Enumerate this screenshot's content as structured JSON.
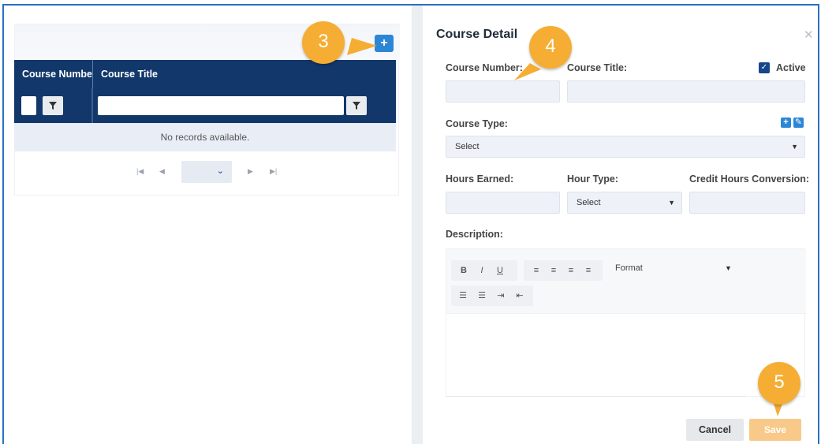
{
  "grid": {
    "columns": [
      "Course Numbe",
      "Course Title"
    ],
    "no_records": "No records available.",
    "add_icon": "plus-icon",
    "filter_icon": "filter-icon",
    "pager_icons": [
      "first-page-icon",
      "prev-page-icon",
      "next-page-icon",
      "last-page-icon"
    ]
  },
  "modal": {
    "title": "Course Detail",
    "close_icon": "close-icon",
    "course_number_label": "Course Number:",
    "course_title_label": "Course Title:",
    "active_label": "Active",
    "active_checked": true,
    "course_type_label": "Course Type:",
    "course_type_value": "Select",
    "hours_earned_label": "Hours Earned:",
    "hour_type_label": "Hour Type:",
    "hour_type_value": "Select",
    "credit_hours_label": "Credit Hours Conversion:",
    "description_label": "Description:",
    "editor_toolbar": [
      "B",
      "I",
      "U"
    ],
    "format_label": "Format",
    "cancel_label": "Cancel",
    "save_label": "Save"
  },
  "callouts": [
    "3",
    "4",
    "5"
  ],
  "colors": {
    "grid_header": "#12386b",
    "accent_blue": "#2b86d6",
    "callout_orange": "#f5ad33",
    "save_disabled": "#f9c98a"
  }
}
